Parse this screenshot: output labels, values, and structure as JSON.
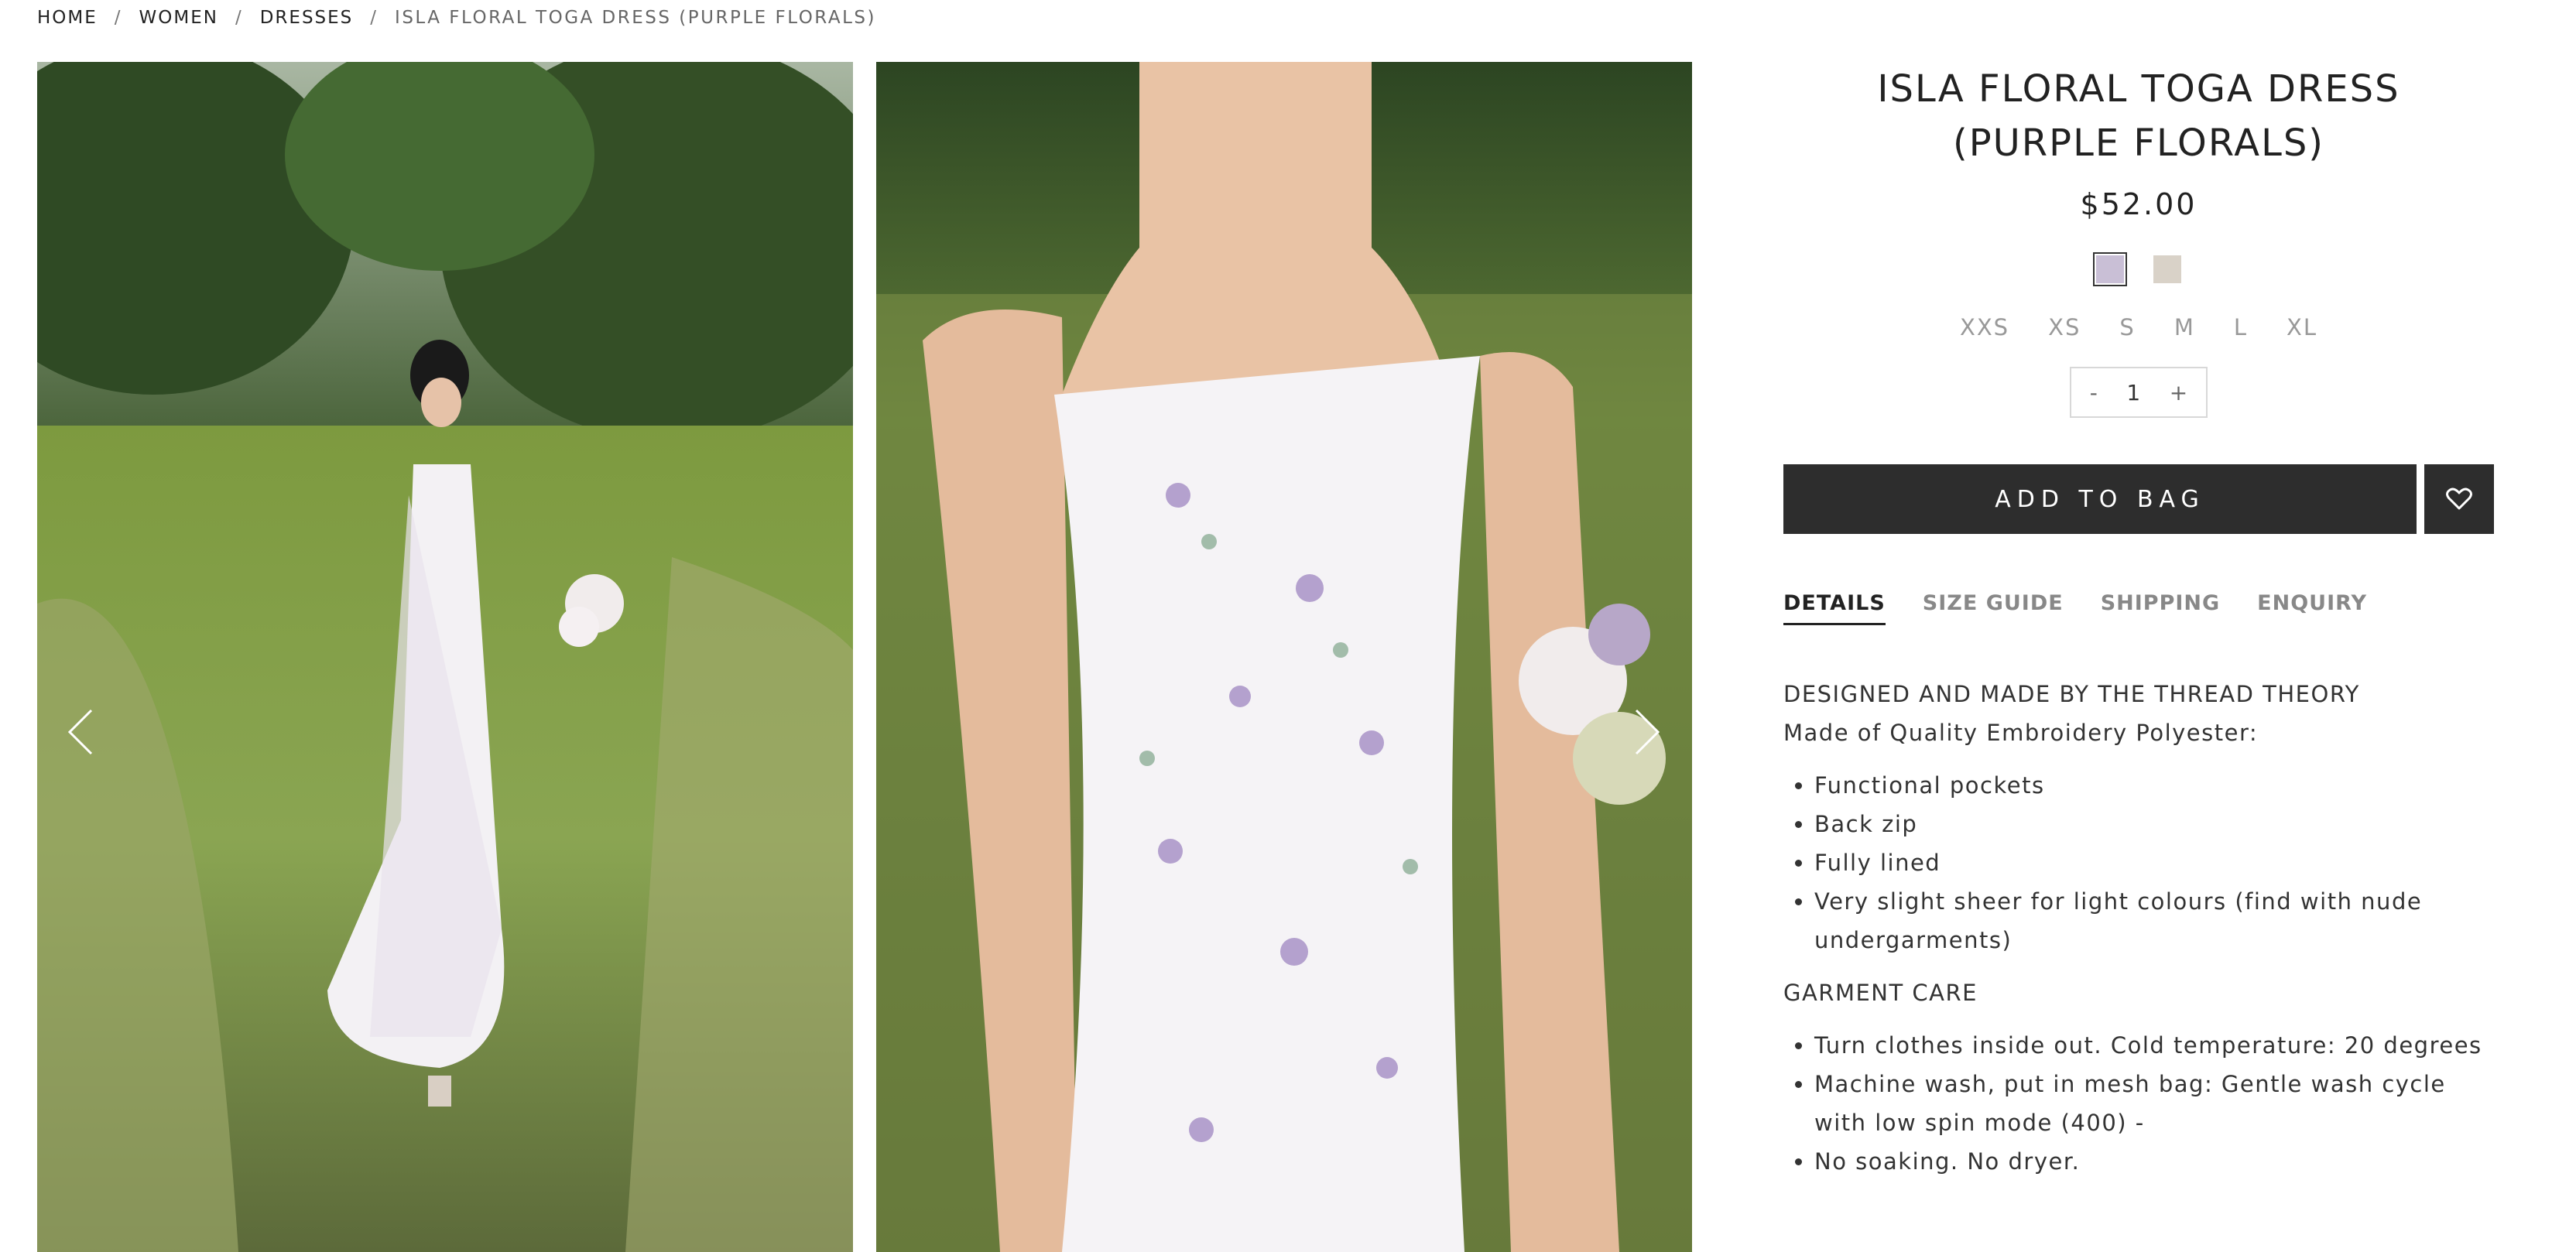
{
  "breadcrumb": {
    "home": "HOME",
    "women": "WOMEN",
    "dresses": "DRESSES",
    "current": "ISLA FLORAL TOGA DRESS (PURPLE FLORALS)",
    "separator": "/"
  },
  "gallery": {
    "prev_icon": "chevron-left-icon",
    "next_icon": "chevron-right-icon"
  },
  "product": {
    "title": "ISLA FLORAL TOGA DRESS (PURPLE FLORALS)",
    "price": "$52.00",
    "swatches": [
      {
        "name": "purple-florals",
        "color": "#c9bfd6",
        "selected": true
      },
      {
        "name": "beige-florals",
        "color": "#d9d2c8",
        "selected": false
      }
    ],
    "sizes": [
      "XXS",
      "XS",
      "S",
      "M",
      "L",
      "XL"
    ],
    "quantity": {
      "minus": "-",
      "value": "1",
      "plus": "+"
    },
    "add_to_bag": "ADD TO BAG",
    "wishlist_icon": "heart-icon"
  },
  "tabs": [
    {
      "label": "DETAILS",
      "active": true
    },
    {
      "label": "SIZE GUIDE",
      "active": false
    },
    {
      "label": "SHIPPING",
      "active": false
    },
    {
      "label": "ENQUIRY",
      "active": false
    }
  ],
  "details": {
    "heading": "DESIGNED AND MADE BY THE THREAD THEORY",
    "material": "Made of Quality Embroidery Polyester:",
    "features": [
      "Functional pockets",
      "Back zip",
      "Fully lined",
      "Very slight sheer for light colours (find with nude undergarments)"
    ],
    "care_heading": "GARMENT CARE",
    "care": [
      "Turn clothes inside out. Cold temperature: 20 degrees",
      "Machine wash, put in mesh bag: Gentle wash cycle with low spin mode (400) -",
      "No soaking. No dryer."
    ]
  },
  "colors": {
    "accent": "#2d2d2d",
    "muted_text": "#888888",
    "border": "#d8d8d8"
  }
}
